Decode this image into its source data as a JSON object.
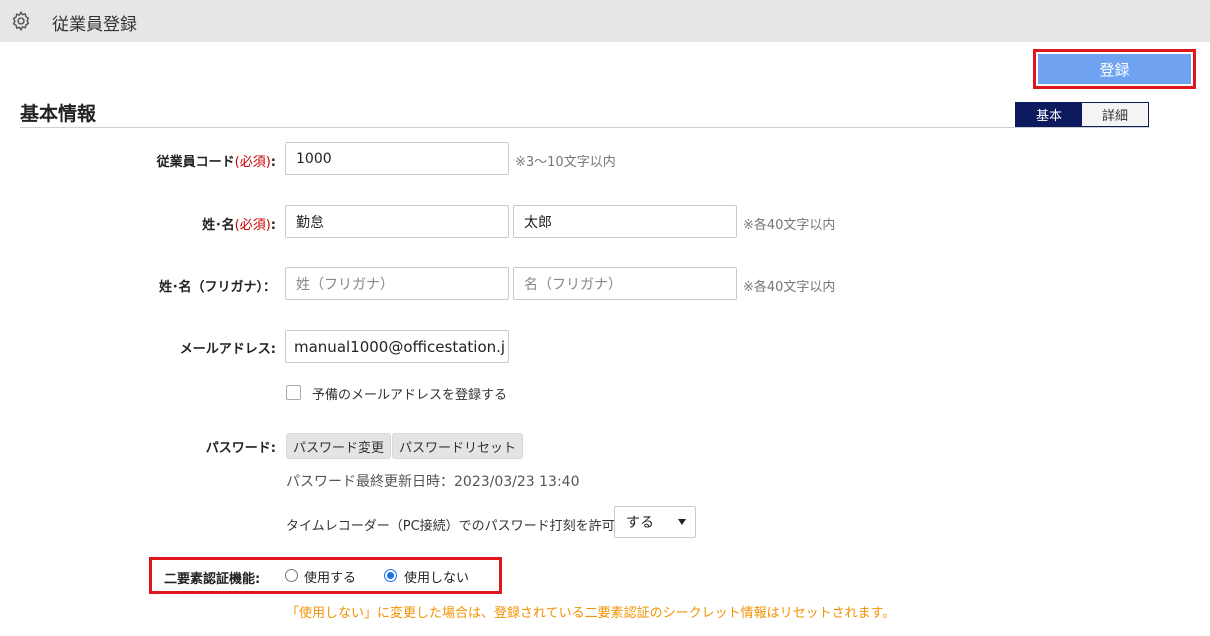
{
  "header": {
    "title": "従業員登録",
    "icon": "gear-icon"
  },
  "toolbar": {
    "register_label": "登録"
  },
  "section": {
    "title": "基本情報"
  },
  "view_toggle": {
    "basic": "基本",
    "detail": "詳細",
    "active": "基本"
  },
  "form": {
    "employee_code": {
      "label": "従業員コード",
      "required": "(必須)",
      "colon": ":",
      "value": "1000",
      "hint": "※3～10文字以内"
    },
    "name": {
      "label": "姓･名",
      "required": "(必須)",
      "colon": ":",
      "last": "勤怠",
      "first": "太郎",
      "hint": "※各40文字以内"
    },
    "name_kana": {
      "label": "姓･名（フリガナ）：",
      "last_placeholder": "姓（フリガナ）",
      "first_placeholder": "名（フリガナ）",
      "hint": "※各40文字以内"
    },
    "email": {
      "label": "メールアドレス:",
      "value": "manual1000@officestation.j"
    },
    "backup_email": {
      "label": "予備のメールアドレスを登録する",
      "checked": false
    },
    "password": {
      "label": "パスワード:",
      "change_label": "パスワード変更",
      "reset_label": "パスワードリセット",
      "last_updated": "パスワード最終更新日時：2023/03/23 13:40"
    },
    "timerecorder": {
      "label": "タイムレコーダー（PC接続）でのパスワード打刻を許可",
      "selected": "する"
    },
    "two_factor": {
      "label": "二要素認証機能:",
      "option_use": "使用する",
      "option_nouse": "使用しない",
      "selected": "使用しない",
      "warning": "「使用しない」に変更した場合は、登録されている二要素認証のシークレット情報はリセットされます。"
    }
  },
  "colors": {
    "accent": "#6fa3f2",
    "highlight": "#e0161f",
    "toggle_active": "#0d1b5e",
    "required": "#cc0000",
    "warning": "#f39200"
  }
}
